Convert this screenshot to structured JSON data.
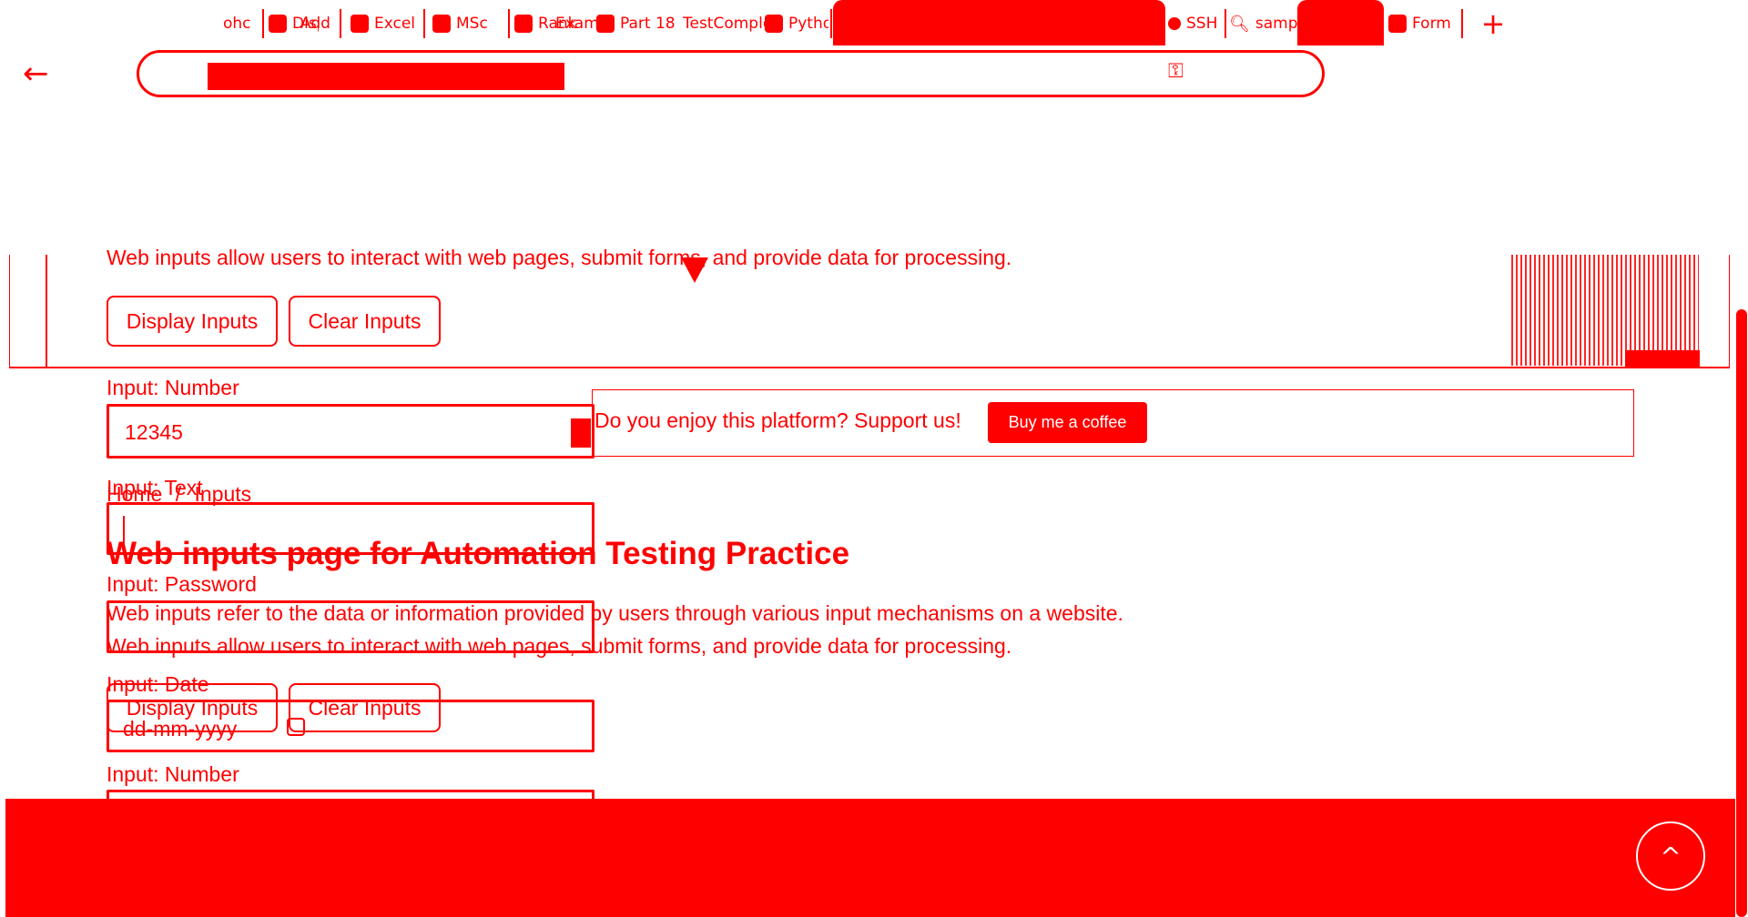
{
  "browser": {
    "tabs": [
      {
        "label": "ohc"
      },
      {
        "label": "Displ"
      },
      {
        "label": "Add"
      },
      {
        "label": "Excel"
      },
      {
        "label": "MSc"
      },
      {
        "label": "Rank"
      },
      {
        "label": "Exam"
      },
      {
        "label": "Part 18"
      },
      {
        "label": "TestComplete"
      },
      {
        "label": "Python"
      },
      {
        "label": "SSH"
      },
      {
        "label": "samp"
      },
      {
        "label": "Form"
      }
    ],
    "new_tab_label": "+",
    "back_label": "←",
    "address_icon": "key-icon"
  },
  "page": {
    "top_text": "Web inputs allow users to interact with web pages, submit forms, and provide data for processing.",
    "buttons": {
      "display": "Display Inputs",
      "clear": "Clear Inputs"
    },
    "form_top": {
      "number_label": "Input: Number",
      "number_value": "12345"
    },
    "support": {
      "text": "Do you enjoy this platform? Support us!",
      "button": "Buy me a coffee"
    },
    "breadcrumb": {
      "home": "Home",
      "separator": "/",
      "current": "Inputs"
    },
    "title": "Web inputs page for Automation Testing Practice",
    "paragraph1": "Web inputs refer to the data or information provided by users through various input mechanisms on a website.",
    "paragraph2": "Web inputs allow users to interact with web pages, submit forms, and provide data for processing.",
    "form": {
      "text_label": "Input: Text",
      "password_label": "Input: Password",
      "date_label": "Input: Date",
      "date_placeholder": "dd-mm-yyyy",
      "number_label": "Input: Number"
    },
    "scroll_top_label": "^"
  },
  "colors": {
    "primary": "#ff0000",
    "background": "#ffffff"
  }
}
